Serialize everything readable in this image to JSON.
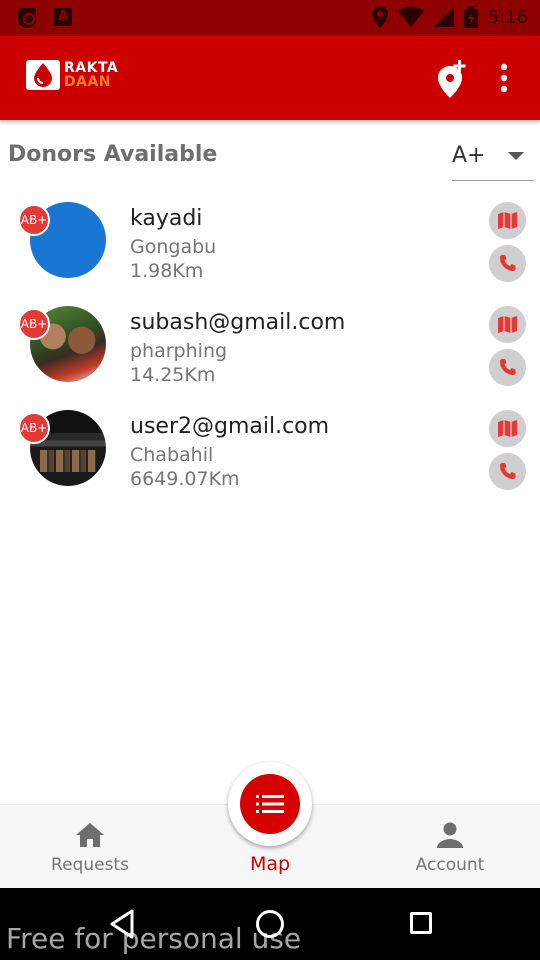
{
  "status_bar": {
    "time": "5:16"
  },
  "app_bar": {
    "logo_line1": "RAKTA",
    "logo_line2": "DAAN",
    "brand_color": "#cc0000",
    "accent_color": "#ff7a33"
  },
  "header": {
    "title": "Donors Available",
    "blood_group_selected": "A+"
  },
  "donors": [
    {
      "blood_group": "AB+",
      "name": "kayadi",
      "location": "Gongabu",
      "distance": "1.98Km",
      "avatar": "blue-circle"
    },
    {
      "blood_group": "AB+",
      "name": "subash@gmail.com",
      "location": "pharphing",
      "distance": "14.25Km",
      "avatar": "photo"
    },
    {
      "blood_group": "AB+",
      "name": "user2@gmail.com",
      "location": "Chabahil",
      "distance": "6649.07Km",
      "avatar": "photo"
    }
  ],
  "bottom_nav": {
    "items": [
      {
        "label": "Requests",
        "icon": "home-icon"
      },
      {
        "label": "Map",
        "icon": "list-icon",
        "active": true
      },
      {
        "label": "Account",
        "icon": "person-icon"
      }
    ]
  },
  "watermark": "Free for personal use"
}
